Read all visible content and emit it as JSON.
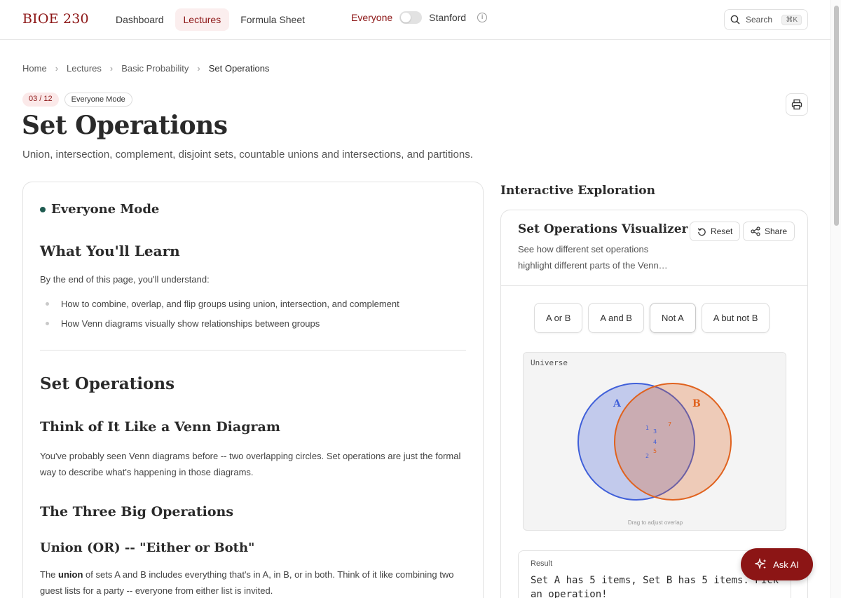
{
  "header": {
    "brand": "BIOE 230",
    "nav": [
      {
        "label": "Dashboard",
        "active": false
      },
      {
        "label": "Lectures",
        "active": true
      },
      {
        "label": "Formula Sheet",
        "active": false
      }
    ],
    "mode_left": "Everyone",
    "mode_right": "Stanford",
    "search_label": "Search",
    "search_shortcut": "⌘K"
  },
  "breadcrumb": [
    "Home",
    "Lectures",
    "Basic Probability",
    "Set Operations"
  ],
  "page": {
    "counter": "03 / 12",
    "mode_badge": "Everyone Mode",
    "title": "Set Operations",
    "subtitle": "Union, intersection, complement, disjoint sets, countable unions and intersections, and partitions."
  },
  "lesson": {
    "mode_heading": "Everyone Mode",
    "learn_heading": "What You'll Learn",
    "learn_intro": "By the end of this page, you'll understand:",
    "learn_bullets": [
      "How to combine, overlap, and flip groups using union, intersection, and complement",
      "How Venn diagrams visually show relationships between groups"
    ],
    "section_heading": "Set Operations",
    "venn_heading": "Think of It Like a Venn Diagram",
    "venn_para": "You've probably seen Venn diagrams before -- two overlapping circles. Set operations are just the formal way to describe what's happening in those diagrams.",
    "three_heading": "The Three Big Operations",
    "union_heading": "Union (OR) -- \"Either or Both\"",
    "union_para_pre": "The ",
    "union_para_bold": "union",
    "union_para_post": " of sets A and B includes everything that's in A, in B, or in both. Think of it like combining two guest lists for a party -- everyone from either list is invited."
  },
  "sidebar": {
    "heading": "Interactive Exploration",
    "viz_title": "Set Operations Visualizer",
    "viz_desc": "See how different set operations highlight different parts of the Venn…",
    "reset_label": "Reset",
    "share_label": "Share",
    "operations": [
      {
        "label": "A or B",
        "selected": false
      },
      {
        "label": "A and B",
        "selected": false
      },
      {
        "label": "Not A",
        "selected": true
      },
      {
        "label": "A but not B",
        "selected": false
      }
    ],
    "venn": {
      "universe_label": "Universe",
      "set_a_label": "A",
      "set_b_label": "B",
      "set_a_color": "#3f5fd9",
      "set_b_color": "#e0621e",
      "elements": [
        "1",
        "2",
        "3",
        "4",
        "5",
        "7"
      ],
      "drag_hint": "Drag to adjust overlap"
    },
    "result_label": "Result",
    "result_text": "Set A has 5 items, Set B has 5 items. Pick an operation!"
  },
  "ask_ai_label": "Ask AI",
  "colors": {
    "brand": "#8c1515",
    "accent_dot": "#1f5b50"
  }
}
